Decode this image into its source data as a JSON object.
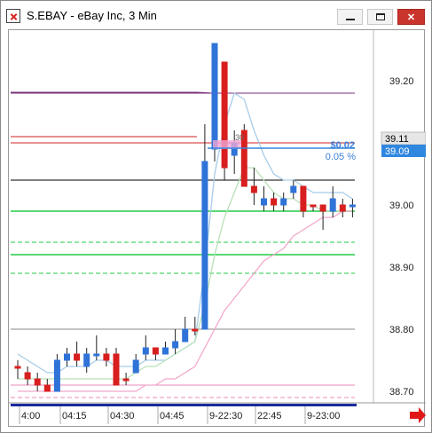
{
  "window": {
    "title": "S.EBAY - eBay Inc, 3 Min",
    "minimize_icon": "minimize-icon",
    "maximize_icon": "maximize-icon",
    "close_icon": "close-icon",
    "close_glyph": "✕"
  },
  "colors": {
    "up_candle": "#2f73d8",
    "down_candle": "#d81e1e",
    "purple_line": "#7a2f7a",
    "red_line": "#d02020",
    "black_line": "#000000",
    "green_line": "#22cc44",
    "gray_line": "#888888",
    "pink_line": "#ee88bb",
    "lightblue_ma": "#a8cce8",
    "lightgreen_ma": "#b8e0b8",
    "pink_ma": "#f2a8cc",
    "current_price_bg": "#2f87e0",
    "last_price_bg": "#e6e6e6",
    "arrow": "#e01818"
  },
  "price_axis": {
    "ticks": [
      "39.20",
      "39.00",
      "38.90",
      "38.80",
      "38.70"
    ],
    "last_price": "39.11",
    "current_price": "39.09"
  },
  "time_axis": {
    "labels": [
      "4:00",
      "04:15",
      "04:30",
      "04:45",
      "9-22:30",
      "22:45",
      "9-23:00"
    ]
  },
  "overlay": {
    "change": "$0.02",
    "percent": "0.05 %",
    "small_label": "30"
  },
  "chart_data": {
    "type": "candlestick",
    "title": "S.EBAY - eBay Inc, 3 Min",
    "ylim": [
      38.66,
      39.28
    ],
    "y_ticks": [
      38.7,
      38.8,
      38.9,
      39.0,
      39.2
    ],
    "horizontal_levels": [
      {
        "value": 39.18,
        "color": "purple"
      },
      {
        "value": 39.1,
        "color": "red"
      },
      {
        "value": 39.04,
        "color": "black"
      },
      {
        "value": 38.99,
        "color": "green"
      },
      {
        "value": 38.94,
        "color": "green",
        "style": "dashed"
      },
      {
        "value": 38.92,
        "color": "green"
      },
      {
        "value": 38.89,
        "color": "green",
        "style": "dashed"
      },
      {
        "value": 38.8,
        "color": "gray"
      },
      {
        "value": 38.71,
        "color": "pink"
      },
      {
        "value": 38.69,
        "color": "pink",
        "style": "dashed"
      }
    ],
    "candles": [
      {
        "o": 38.74,
        "h": 38.75,
        "l": 38.72,
        "c": 38.74,
        "dir": "down"
      },
      {
        "o": 38.73,
        "h": 38.74,
        "l": 38.71,
        "c": 38.72,
        "dir": "down"
      },
      {
        "o": 38.72,
        "h": 38.73,
        "l": 38.7,
        "c": 38.71,
        "dir": "down"
      },
      {
        "o": 38.71,
        "h": 38.72,
        "l": 38.7,
        "c": 38.7,
        "dir": "down"
      },
      {
        "o": 38.7,
        "h": 38.76,
        "l": 38.7,
        "c": 38.75,
        "dir": "up"
      },
      {
        "o": 38.75,
        "h": 38.77,
        "l": 38.74,
        "c": 38.76,
        "dir": "up"
      },
      {
        "o": 38.76,
        "h": 38.78,
        "l": 38.74,
        "c": 38.75,
        "dir": "down"
      },
      {
        "o": 38.74,
        "h": 38.77,
        "l": 38.73,
        "c": 38.76,
        "dir": "up"
      },
      {
        "o": 38.76,
        "h": 38.79,
        "l": 38.75,
        "c": 38.76,
        "dir": "up"
      },
      {
        "o": 38.76,
        "h": 38.77,
        "l": 38.74,
        "c": 38.75,
        "dir": "down"
      },
      {
        "o": 38.76,
        "h": 38.77,
        "l": 38.71,
        "c": 38.71,
        "dir": "down"
      },
      {
        "o": 38.72,
        "h": 38.73,
        "l": 38.71,
        "c": 38.72,
        "dir": "down"
      },
      {
        "o": 38.73,
        "h": 38.76,
        "l": 38.73,
        "c": 38.75,
        "dir": "up"
      },
      {
        "o": 38.76,
        "h": 38.79,
        "l": 38.75,
        "c": 38.77,
        "dir": "up"
      },
      {
        "o": 38.77,
        "h": 38.77,
        "l": 38.75,
        "c": 38.76,
        "dir": "down"
      },
      {
        "o": 38.76,
        "h": 38.78,
        "l": 38.76,
        "c": 38.77,
        "dir": "up"
      },
      {
        "o": 38.77,
        "h": 38.8,
        "l": 38.76,
        "c": 38.78,
        "dir": "up"
      },
      {
        "o": 38.78,
        "h": 38.82,
        "l": 38.78,
        "c": 38.8,
        "dir": "up"
      },
      {
        "o": 38.8,
        "h": 38.82,
        "l": 38.79,
        "c": 38.8,
        "dir": "down"
      },
      {
        "o": 38.8,
        "h": 39.13,
        "l": 38.8,
        "c": 39.07,
        "dir": "up"
      },
      {
        "o": 39.09,
        "h": 39.26,
        "l": 39.07,
        "c": 39.26,
        "dir": "up"
      },
      {
        "o": 39.23,
        "h": 39.23,
        "l": 39.04,
        "c": 39.06,
        "dir": "down"
      },
      {
        "o": 39.1,
        "h": 39.12,
        "l": 39.05,
        "c": 39.08,
        "dir": "up"
      },
      {
        "o": 39.12,
        "h": 39.13,
        "l": 39.04,
        "c": 39.03,
        "dir": "down"
      },
      {
        "o": 39.03,
        "h": 39.06,
        "l": 39.0,
        "c": 39.02,
        "dir": "down"
      },
      {
        "o": 39.0,
        "h": 39.03,
        "l": 38.99,
        "c": 39.01,
        "dir": "up"
      },
      {
        "o": 39.01,
        "h": 39.02,
        "l": 38.99,
        "c": 39.0,
        "dir": "down"
      },
      {
        "o": 39.0,
        "h": 39.02,
        "l": 38.99,
        "c": 39.01,
        "dir": "up"
      },
      {
        "o": 39.02,
        "h": 39.04,
        "l": 39.01,
        "c": 39.03,
        "dir": "up"
      },
      {
        "o": 39.03,
        "h": 39.03,
        "l": 38.98,
        "c": 38.99,
        "dir": "down"
      },
      {
        "o": 39.0,
        "h": 39.0,
        "l": 38.99,
        "c": 39.0,
        "dir": "down"
      },
      {
        "o": 39.0,
        "h": 39.0,
        "l": 38.96,
        "c": 38.99,
        "dir": "down"
      },
      {
        "o": 38.99,
        "h": 39.03,
        "l": 38.98,
        "c": 39.01,
        "dir": "up"
      },
      {
        "o": 39.0,
        "h": 39.01,
        "l": 38.98,
        "c": 38.99,
        "dir": "down"
      },
      {
        "o": 39.0,
        "h": 39.01,
        "l": 38.98,
        "c": 39.0,
        "dir": "up"
      }
    ]
  }
}
